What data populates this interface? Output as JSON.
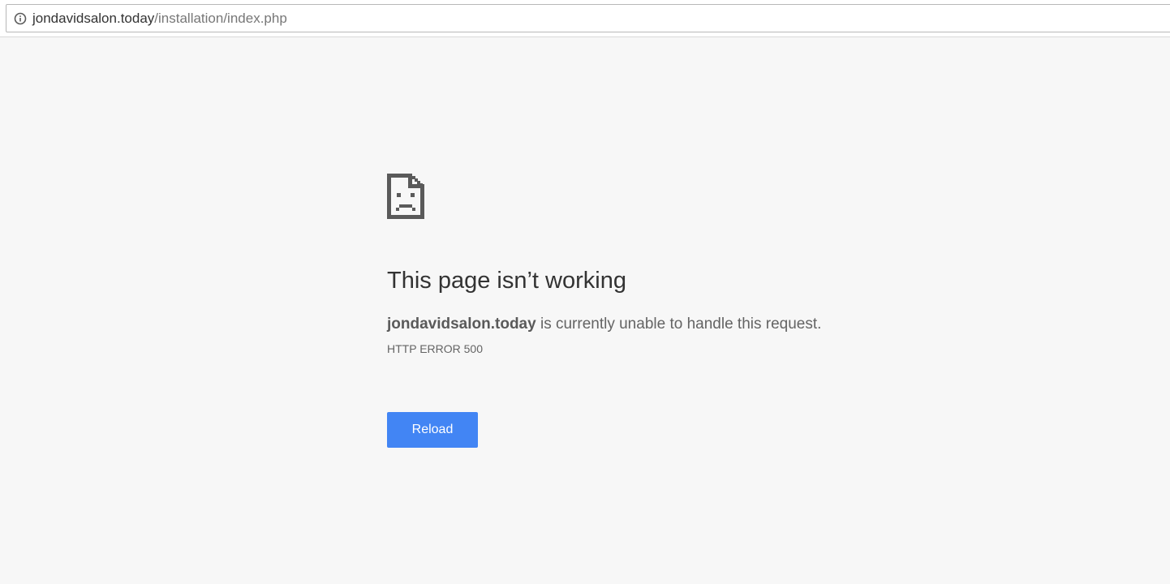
{
  "address_bar": {
    "host": "jondavidsalon.today",
    "path": "/installation/index.php",
    "icon": "info-icon"
  },
  "error_page": {
    "icon": "sad-page-icon",
    "title": "This page isn’t working",
    "host_bold": "jondavidsalon.today",
    "message_rest": " is currently unable to handle this request.",
    "error_code": "HTTP ERROR 500",
    "reload_label": "Reload"
  },
  "colors": {
    "background": "#f7f7f7",
    "button": "#4285f4",
    "title": "#333333",
    "body_text": "#646464",
    "icon": "#5a5a5a"
  }
}
